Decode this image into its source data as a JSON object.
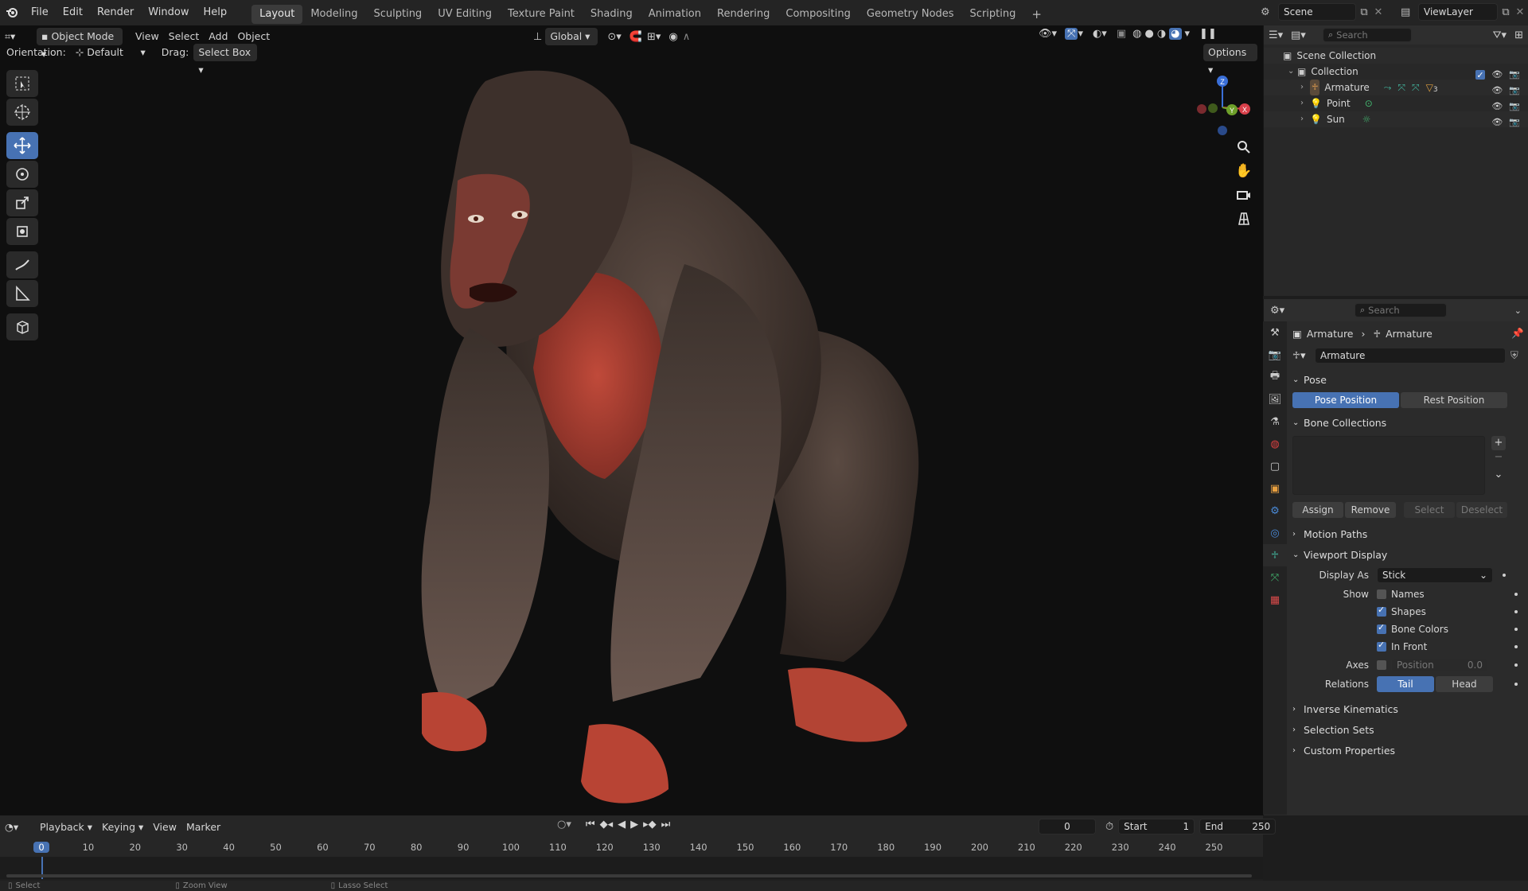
{
  "app": {
    "name": "Blender",
    "accent": "#4772b3"
  },
  "topbar": {
    "menus": [
      "File",
      "Edit",
      "Render",
      "Window",
      "Help"
    ],
    "workspaces": [
      "Layout",
      "Modeling",
      "Sculpting",
      "UV Editing",
      "Texture Paint",
      "Shading",
      "Animation",
      "Rendering",
      "Compositing",
      "Geometry Nodes",
      "Scripting"
    ],
    "active_workspace": "Layout",
    "scene": "Scene",
    "view_layer": "ViewLayer"
  },
  "viewport_header": {
    "mode": "Object Mode",
    "menus": [
      "View",
      "Select",
      "Add",
      "Object"
    ],
    "transform_orientation": "Global",
    "orientation_label": "Orientation:",
    "orientation_value": "Default",
    "drag_label": "Drag:",
    "drag_value": "Select Box",
    "options_label": "Options"
  },
  "gizmo": {
    "x": "X",
    "y": "Y",
    "z": "Z"
  },
  "outliner": {
    "search_placeholder": "Search",
    "root": "Scene Collection",
    "collection": "Collection",
    "items": [
      {
        "name": "Armature",
        "icon": "armature-icon"
      },
      {
        "name": "Point",
        "icon": "light-icon"
      },
      {
        "name": "Sun",
        "icon": "light-icon"
      }
    ],
    "armature_badge": "3"
  },
  "properties": {
    "search_placeholder": "Search",
    "breadcrumb": [
      "Armature",
      "Armature"
    ],
    "data_name": "Armature",
    "pose": {
      "title": "Pose",
      "pose_position": "Pose Position",
      "rest_position": "Rest Position"
    },
    "bone_collections": {
      "title": "Bone Collections",
      "assign": "Assign",
      "remove": "Remove",
      "select": "Select",
      "deselect": "Deselect"
    },
    "motion_paths": "Motion Paths",
    "viewport_display": {
      "title": "Viewport Display",
      "display_as_label": "Display As",
      "display_as_value": "Stick",
      "show_label": "Show",
      "names": "Names",
      "shapes": "Shapes",
      "bone_colors": "Bone Colors",
      "in_front": "In Front",
      "axes_label": "Axes",
      "position_label": "Position",
      "position_value": "0.0",
      "relations_label": "Relations",
      "tail": "Tail",
      "head": "Head"
    },
    "inverse_kinematics": "Inverse Kinematics",
    "selection_sets": "Selection Sets",
    "custom_properties": "Custom Properties"
  },
  "timeline": {
    "menus": [
      "Playback",
      "Keying",
      "View",
      "Marker"
    ],
    "current_frame": "0",
    "start_label": "Start",
    "start": "1",
    "end_label": "End",
    "end": "250",
    "ruler": [
      "0",
      "10",
      "20",
      "30",
      "40",
      "50",
      "60",
      "70",
      "80",
      "90",
      "100",
      "110",
      "120",
      "130",
      "140",
      "150",
      "160",
      "170",
      "180",
      "190",
      "200",
      "210",
      "220",
      "230",
      "240",
      "250"
    ]
  },
  "statusbar": {
    "items": [
      "Select",
      "Zoom View",
      "Lasso Select"
    ]
  }
}
